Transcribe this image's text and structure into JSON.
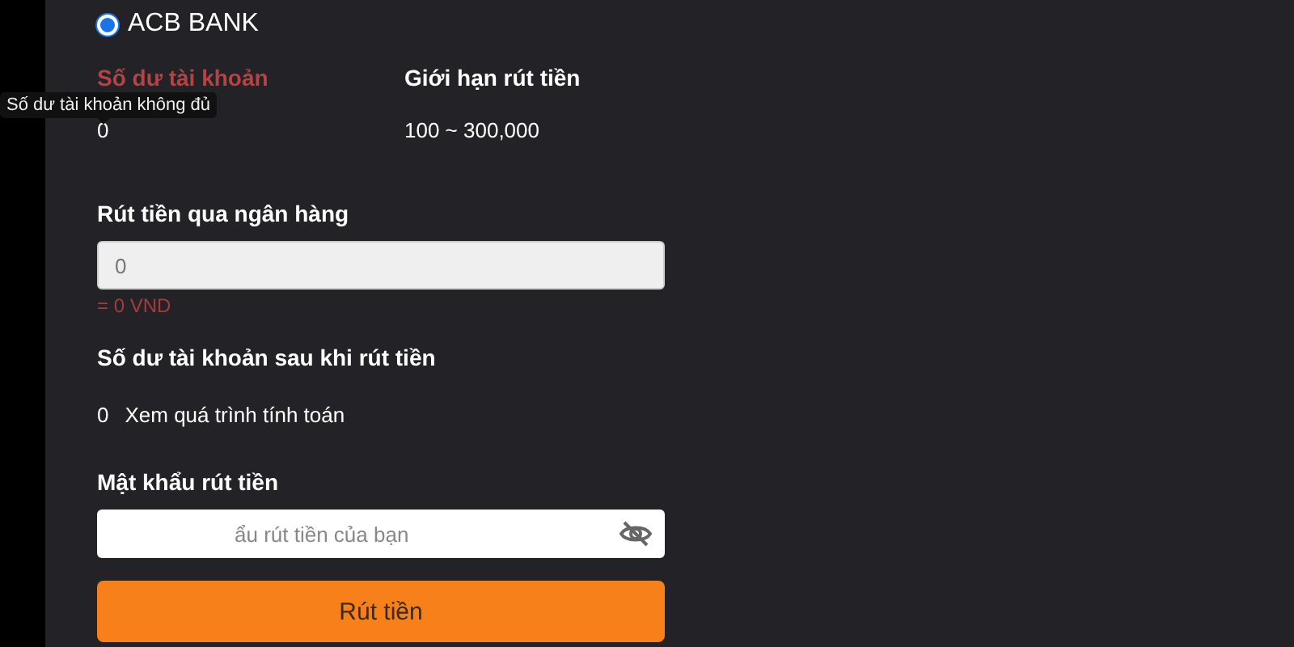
{
  "bank": {
    "name": "ACB BANK",
    "selected": true
  },
  "balance": {
    "label": "Số dư tài khoản",
    "value": "0",
    "tooltip": "Số dư tài khoản không đủ"
  },
  "limit": {
    "label": "Giới hạn rút tiền",
    "value": "100 ~ 300,000"
  },
  "amount": {
    "label": "Rút tiền qua ngân hàng",
    "placeholder": "0",
    "converted": "= 0 VND"
  },
  "after": {
    "label": "Số dư tài khoản sau khi rút tiền",
    "value": "0",
    "link": "Xem quá trình tính toán"
  },
  "password": {
    "label": "Mật khẩu rút tiền",
    "placeholder": "ẩu rút tiền của bạn"
  },
  "submit": "Rút tiền"
}
